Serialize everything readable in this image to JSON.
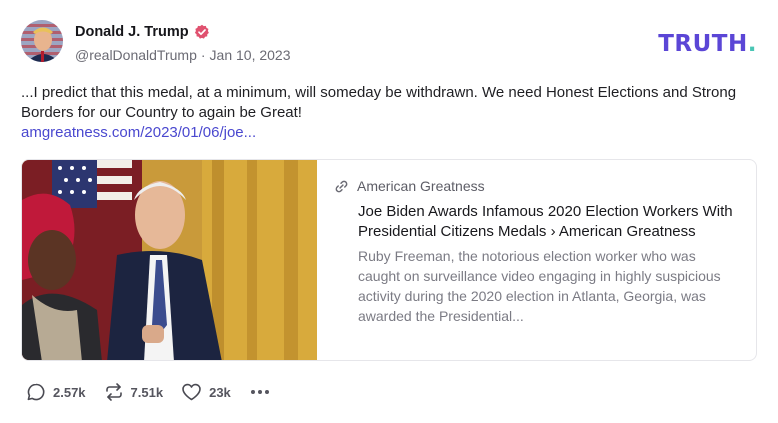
{
  "author": {
    "display_name": "Donald J. Trump",
    "handle": "@realDonaldTrump",
    "separator": "·",
    "date": "Jan 10, 2023",
    "verified_icon": "verified-badge-icon",
    "verified_color": "#e0516f"
  },
  "brand": {
    "logo_text": "TRUTH",
    "logo_dot": ".",
    "logo_color": "#5b46d6",
    "dot_color": "#49c6b4"
  },
  "post": {
    "text": "...I predict that this medal, at a minimum, will someday be withdrawn. We need Honest Elections and Strong Borders for our Country to again be Great!",
    "link_text": "amgreatness.com/2023/01/06/joe..."
  },
  "card": {
    "source": "American Greatness",
    "source_icon": "link-icon",
    "title": "Joe Biden Awards Infamous 2020 Election Workers With Presidential Citizens Medals › American Greatness",
    "description": "Ruby Freeman, the notorious election worker who was caught on surveillance video engaging in highly suspicious activity during the 2020 election in Atlanta, Georgia, was awarded the Presidential..."
  },
  "actions": {
    "replies": "2.57k",
    "retruths": "7.51k",
    "likes": "23k"
  }
}
